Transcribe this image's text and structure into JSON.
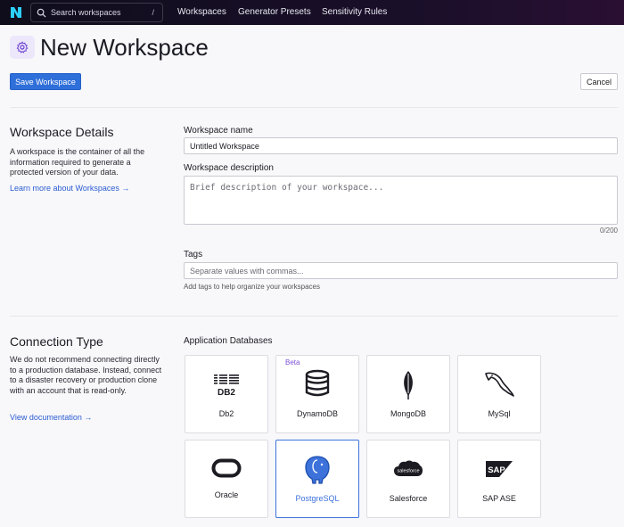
{
  "topbar": {
    "search_placeholder": "Search workspaces",
    "search_shortcut": "/",
    "nav": [
      "Workspaces",
      "Generator Presets",
      "Sensitivity Rules"
    ]
  },
  "page": {
    "title": "New Workspace",
    "save_label": "Save Workspace",
    "cancel_label": "Cancel"
  },
  "details": {
    "title": "Workspace Details",
    "description": "A workspace is the container of all the information required to generate a protected version of your data.",
    "link": "Learn more about Workspaces →",
    "name_label": "Workspace name",
    "name_value": "Untitled Workspace",
    "description_label": "Workspace description",
    "description_placeholder": "Brief description of your workspace...",
    "description_counter": "0/200",
    "tags_label": "Tags",
    "tags_placeholder": "Separate values with commas...",
    "tags_hint": "Add tags to help organize your workspaces"
  },
  "connection": {
    "title": "Connection Type",
    "description": "We do not recommend connecting directly to a production database. Instead, connect to a disaster recovery or production clone with an account that is read-only.",
    "link": "View documentation →",
    "databases_heading": "Application Databases",
    "databases": [
      {
        "name": "Db2",
        "icon": "ibm-db2-icon"
      },
      {
        "name": "DynamoDB",
        "icon": "dynamodb-icon",
        "badge": "Beta"
      },
      {
        "name": "MongoDB",
        "icon": "mongodb-leaf-icon"
      },
      {
        "name": "MySql",
        "icon": "mysql-dolphin-icon"
      },
      {
        "name": "Oracle",
        "icon": "oracle-icon"
      },
      {
        "name": "PostgreSQL",
        "icon": "postgresql-elephant-icon",
        "selected": true
      },
      {
        "name": "Salesforce",
        "icon": "salesforce-cloud-icon"
      },
      {
        "name": "SAP ASE",
        "icon": "sap-icon"
      }
    ]
  },
  "colors": {
    "primary": "#2f6fd9",
    "selected_border": "#3d72db",
    "beta": "#7a4fd6",
    "topbar": "#120f20"
  }
}
